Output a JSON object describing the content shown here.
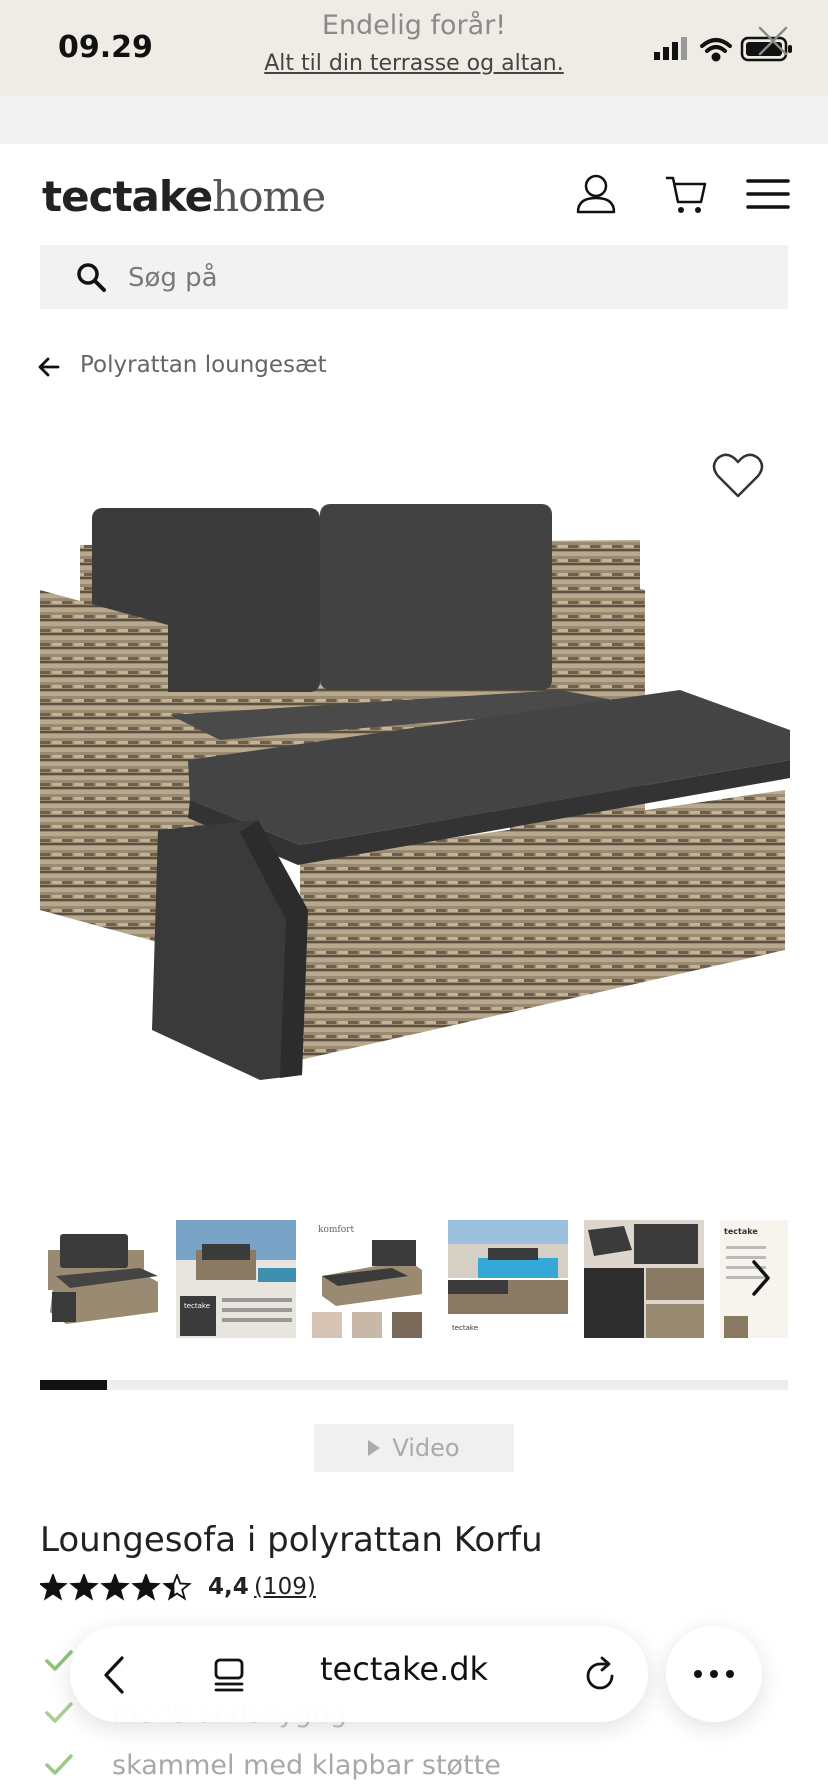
{
  "status_bar": {
    "time": "09.29"
  },
  "promo": {
    "title": "Endelig forår!",
    "link": "Alt til din terrasse og altan."
  },
  "header": {
    "logo_bold": "tectake",
    "logo_light": "home"
  },
  "search": {
    "placeholder": "Søg på"
  },
  "breadcrumb": {
    "label": "Polyrattan loungesæt"
  },
  "gallery": {
    "thumb_count_visible": 6,
    "progress_fraction": 0.09,
    "thumb_captions": [
      "tectake",
      "komfort",
      "tectake",
      "tectake"
    ]
  },
  "video_button": {
    "label": "Video"
  },
  "product": {
    "title": "Loungesofa i polyrattan Korfu",
    "rating_value": 4.4,
    "rating_text": "4,4",
    "review_count": "(109)",
    "features": [
      "p",
      "modstandsdygtig",
      "skammel med klapbar støtte"
    ]
  },
  "browser_bar": {
    "url": "tectake.dk"
  },
  "colors": {
    "cushion": "#3c3c3d",
    "rattan": "#8a7a63",
    "banner_bg": "#efece6",
    "search_bg": "#f2f2f2",
    "check": "#6aa84f"
  }
}
